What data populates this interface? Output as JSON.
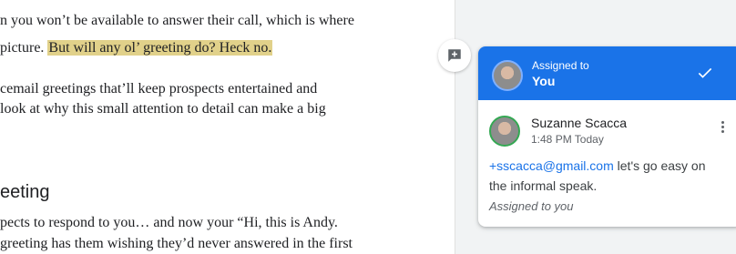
{
  "document": {
    "lines": [
      "n you won’t be available to answer their call, which is where",
      " picture. ",
      "cemail greetings that’ll keep prospects entertained and",
      "look at why this small attention to detail can make a big",
      "pects to respond to you… and now your “Hi, this is Andy.",
      " greeting has them wishing they’d never answered in the first"
    ],
    "highlighted": "But will any ol’ greeting do? Heck no.",
    "heading": "eeting"
  },
  "comment_card": {
    "header": {
      "assigned_label": "Assigned to",
      "assignee": "You"
    },
    "author": "Suzanne Scacca",
    "time": "1:48 PM Today",
    "mention": "+sscacca@gmail.com",
    "body": " let's go easy on the informal speak.",
    "footer": "Assigned to you"
  },
  "colors": {
    "accent": "#1a73e8",
    "highlight": "#e1d18a",
    "gutter": "#f1f3f4"
  },
  "icons": {
    "add_comment": "add-comment-icon",
    "resolve": "checkmark-icon",
    "more": "more-vert-icon"
  }
}
